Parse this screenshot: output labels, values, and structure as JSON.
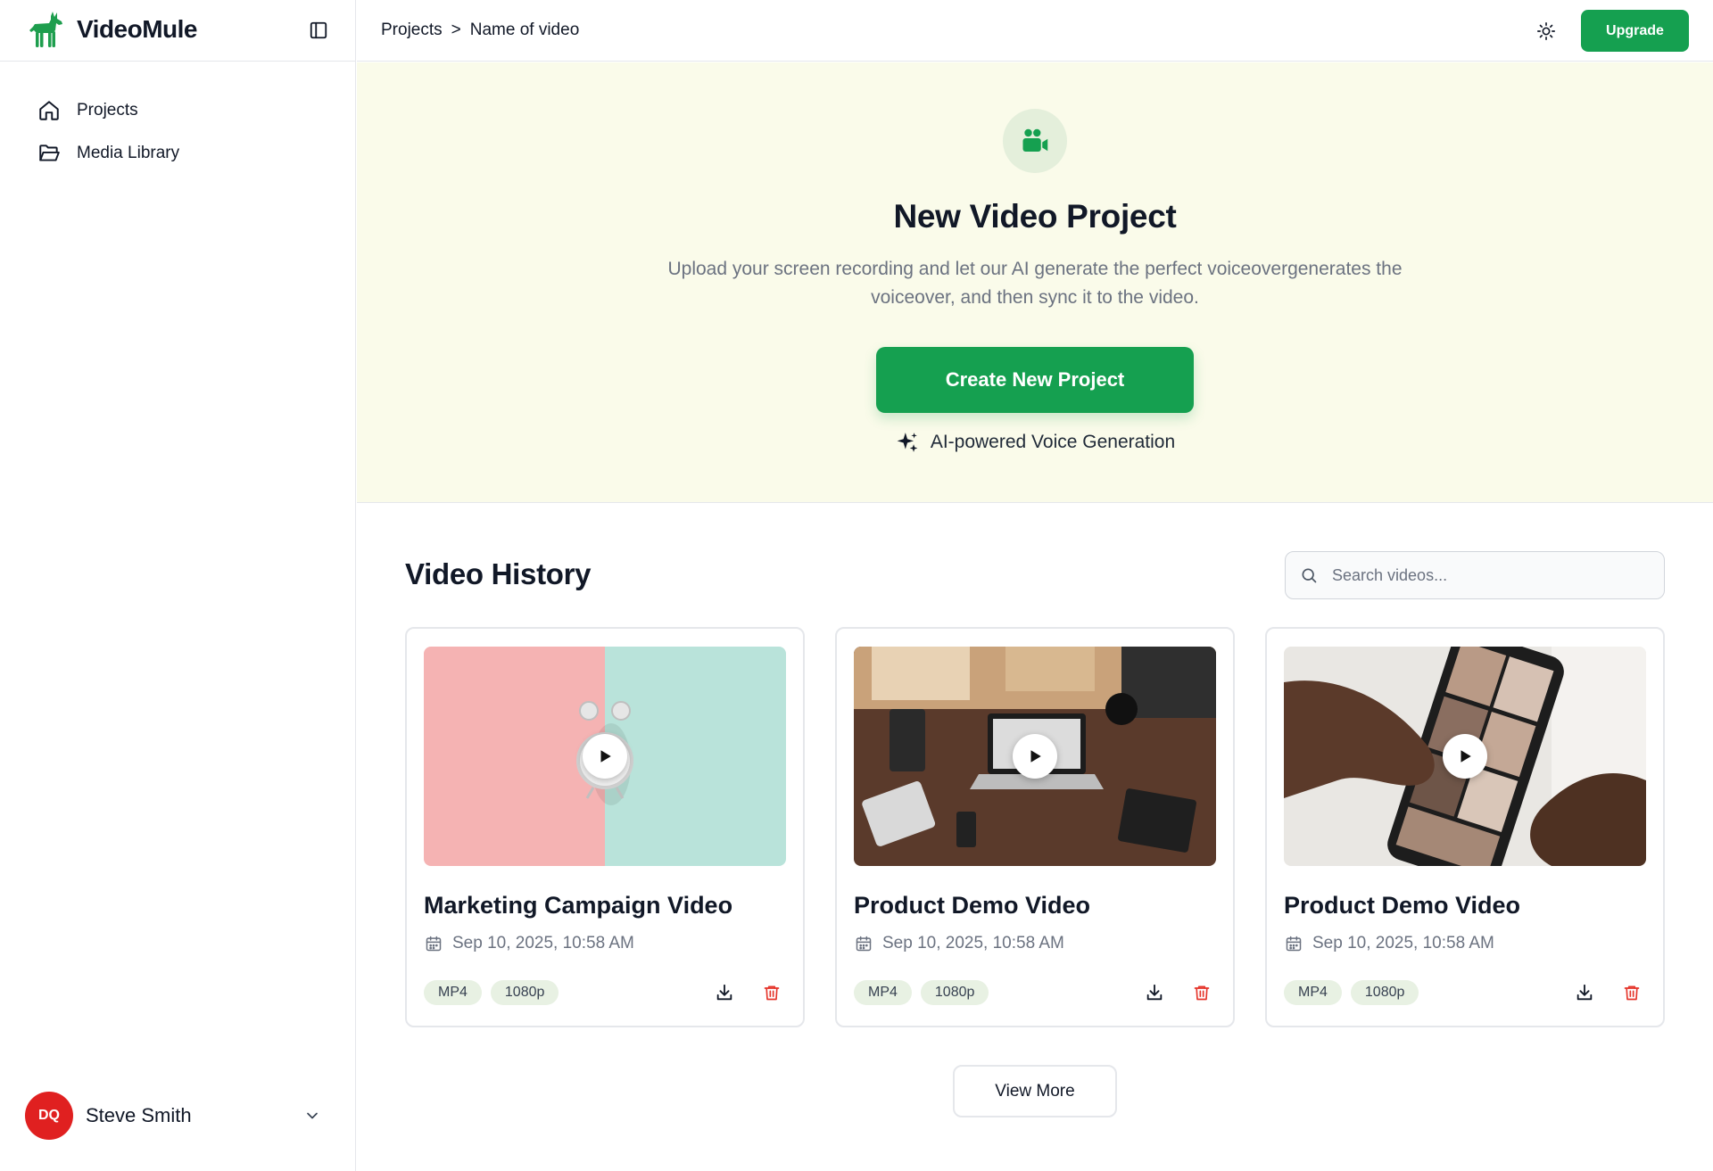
{
  "brand": {
    "name": "VideoMule",
    "accent": "#15a050"
  },
  "sidebar": {
    "items": [
      {
        "label": "Projects",
        "icon": "home-icon"
      },
      {
        "label": "Media Library",
        "icon": "folder-open-icon"
      }
    ],
    "user": {
      "initials": "DQ",
      "name": "Steve Smith",
      "avatar_color": "#e02020"
    }
  },
  "topbar": {
    "breadcrumb": [
      "Projects",
      ">",
      "Name of video"
    ],
    "upgrade_label": "Upgrade"
  },
  "hero": {
    "title": "New Video Project",
    "description": "Upload your screen recording and let our AI generate the perfect voiceovergenerates the voiceover, and then sync it to the video.",
    "create_label": "Create New Project",
    "ai_note": "AI-powered Voice Generation",
    "bg_color": "#fafbea"
  },
  "history": {
    "title": "Video History",
    "search_placeholder": "Search videos...",
    "view_more_label": "View More",
    "videos": [
      {
        "title": "Marketing Campaign Video",
        "date": "Sep 10, 2025, 10:58 AM",
        "format": "MP4",
        "resolution": "1080p",
        "thumbnail": "alarm-clock-pastel-image"
      },
      {
        "title": "Product Demo Video",
        "date": "Sep 10, 2025, 10:58 AM",
        "format": "MP4",
        "resolution": "1080p",
        "thumbnail": "desk-laptop-image"
      },
      {
        "title": "Product Demo Video",
        "date": "Sep 10, 2025, 10:58 AM",
        "format": "MP4",
        "resolution": "1080p",
        "thumbnail": "hands-on-phone-image"
      }
    ]
  }
}
